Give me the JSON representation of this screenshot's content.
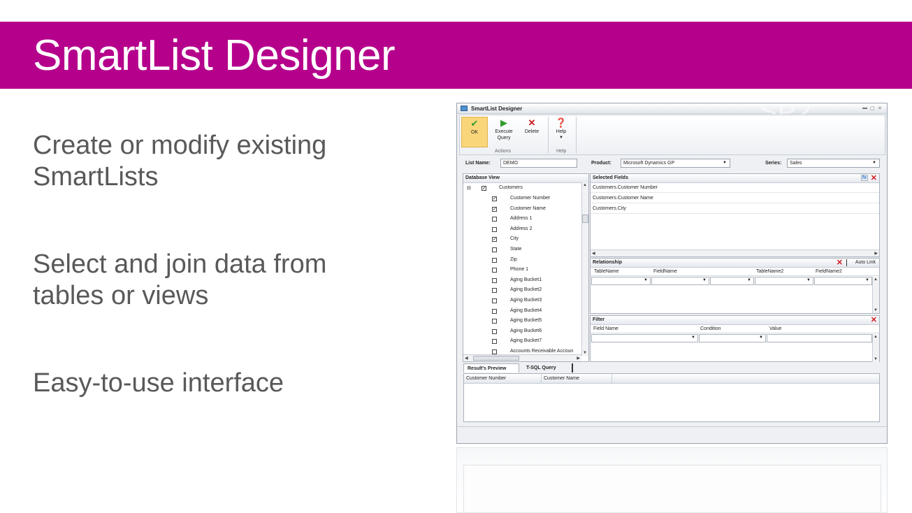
{
  "slide": {
    "title": "SmartList Designer",
    "accent_color": "#b5008c",
    "bullets": [
      "Create or modify existing SmartLists",
      "Select and join data from tables or views",
      "Easy-to-use interface"
    ]
  },
  "app": {
    "window_title": "SmartList Designer",
    "watermark": "SP2",
    "ribbon": {
      "ok": "OK",
      "execute_query": "Execute Query",
      "delete": "Delete",
      "help": "Help",
      "actions_group": "Actions",
      "help_group": "Help"
    },
    "list_name_label": "List Name:",
    "list_name_value": "DEMO",
    "product_label": "Product:",
    "product_value": "Microsoft Dynamics GP",
    "series_label": "Series:",
    "series_value": "Sales",
    "database_view": {
      "header": "Database View",
      "root": "Customers",
      "items": [
        {
          "label": "Customer Number",
          "checked": true
        },
        {
          "label": "Customer Name",
          "checked": true
        },
        {
          "label": "Address 1",
          "checked": false
        },
        {
          "label": "Address 2",
          "checked": false
        },
        {
          "label": "City",
          "checked": true
        },
        {
          "label": "State",
          "checked": false
        },
        {
          "label": "Zip",
          "checked": false
        },
        {
          "label": "Phone 1",
          "checked": false
        },
        {
          "label": "Aging Bucket1",
          "checked": false
        },
        {
          "label": "Aging Bucket2",
          "checked": false
        },
        {
          "label": "Aging Bucket3",
          "checked": false
        },
        {
          "label": "Aging Bucket4",
          "checked": false
        },
        {
          "label": "Aging Bucket5",
          "checked": false
        },
        {
          "label": "Aging Bucket6",
          "checked": false
        },
        {
          "label": "Aging Bucket7",
          "checked": false
        },
        {
          "label": "Accounts Receivable Accoun",
          "checked": false
        }
      ]
    },
    "selected_fields": {
      "header": "Selected Fields",
      "fields": [
        "Customers.Customer Number",
        "Customers.Customer Name",
        "Customers.City"
      ]
    },
    "relationship": {
      "header": "Relationship",
      "auto_link": "Auto Link",
      "columns": [
        "TableName",
        "FieldName",
        "TableName2",
        "FieldName2"
      ]
    },
    "filter": {
      "header": "Filter",
      "columns": [
        "Field Name",
        "Condition",
        "Value"
      ]
    },
    "tabs": [
      "Result's Preview",
      "T-SQL Query"
    ],
    "preview_columns": [
      "Customer Number",
      "Customer Name"
    ]
  }
}
